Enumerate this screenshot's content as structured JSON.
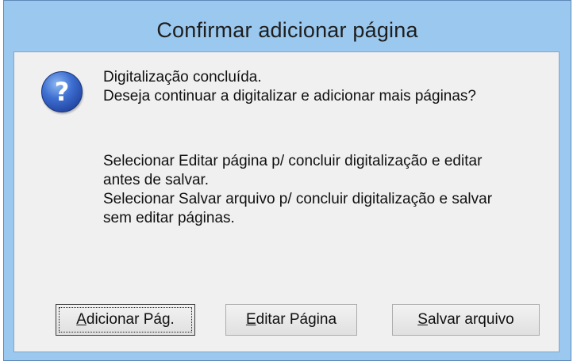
{
  "window": {
    "title": "Confirmar adicionar página"
  },
  "message": {
    "line1": "Digitalização concluída.",
    "line2": "Deseja continuar a digitalizar e adicionar mais páginas?",
    "line3": "Selecionar Editar página p/ concluir digitalização e editar",
    "line4": "antes de salvar.",
    "line5": "Selecionar Salvar arquivo p/ concluir digitalização e salvar",
    "line6": "sem editar páginas."
  },
  "buttons": {
    "add": {
      "mnemonic": "A",
      "rest": "dicionar Pág."
    },
    "edit": {
      "mnemonic": "E",
      "rest": "ditar Página"
    },
    "save": {
      "mnemonic": "S",
      "rest": "alvar arquivo"
    }
  },
  "icon": "question-icon",
  "colors": {
    "titlebar": "#9ac8ee",
    "client": "#f0f0f0",
    "icon_blue": "#2f58c0"
  }
}
